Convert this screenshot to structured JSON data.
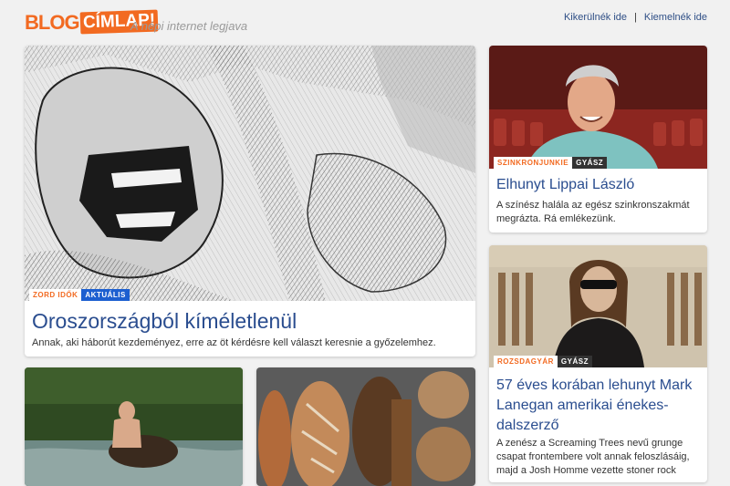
{
  "header": {
    "logo_blog": "BLOG",
    "logo_cimlap": "CÍMLAP!",
    "tagline": "A népi internet legjava",
    "link_left": "Kikerülnék ide",
    "separator": "|",
    "link_right": "Kiemelnék ide"
  },
  "main_article": {
    "category": "ZORD IDŐK",
    "type": "AKTUÁLIS",
    "title": "Oroszországból kíméletlenül",
    "lead": "Annak, aki háborút kezdeményez, erre az öt kérdésre kell választ keresnie a győzelemhez."
  },
  "side_article_1": {
    "category": "SZINKRONJUNKIE",
    "type": "GYÁSZ",
    "title": "Elhunyt Lippai László",
    "lead": "A színész halála az egész szinkronszakmát megrázta. Rá emlékezünk."
  },
  "side_article_2": {
    "category": "ROZSDAGYÁR",
    "type": "GYÁSZ",
    "title": "57 éves korában lehunyt Mark Lanegan amerikai énekes-dalszerző",
    "lead": "A zenész a Screaming Trees nevű grunge csapat frontembere volt annak feloszlásáig, majd a Josh Homme vezette stoner rock"
  },
  "colors": {
    "accent": "#f26a21",
    "title_blue": "#2a4d8f",
    "tag_blue": "#1c5fd0"
  }
}
